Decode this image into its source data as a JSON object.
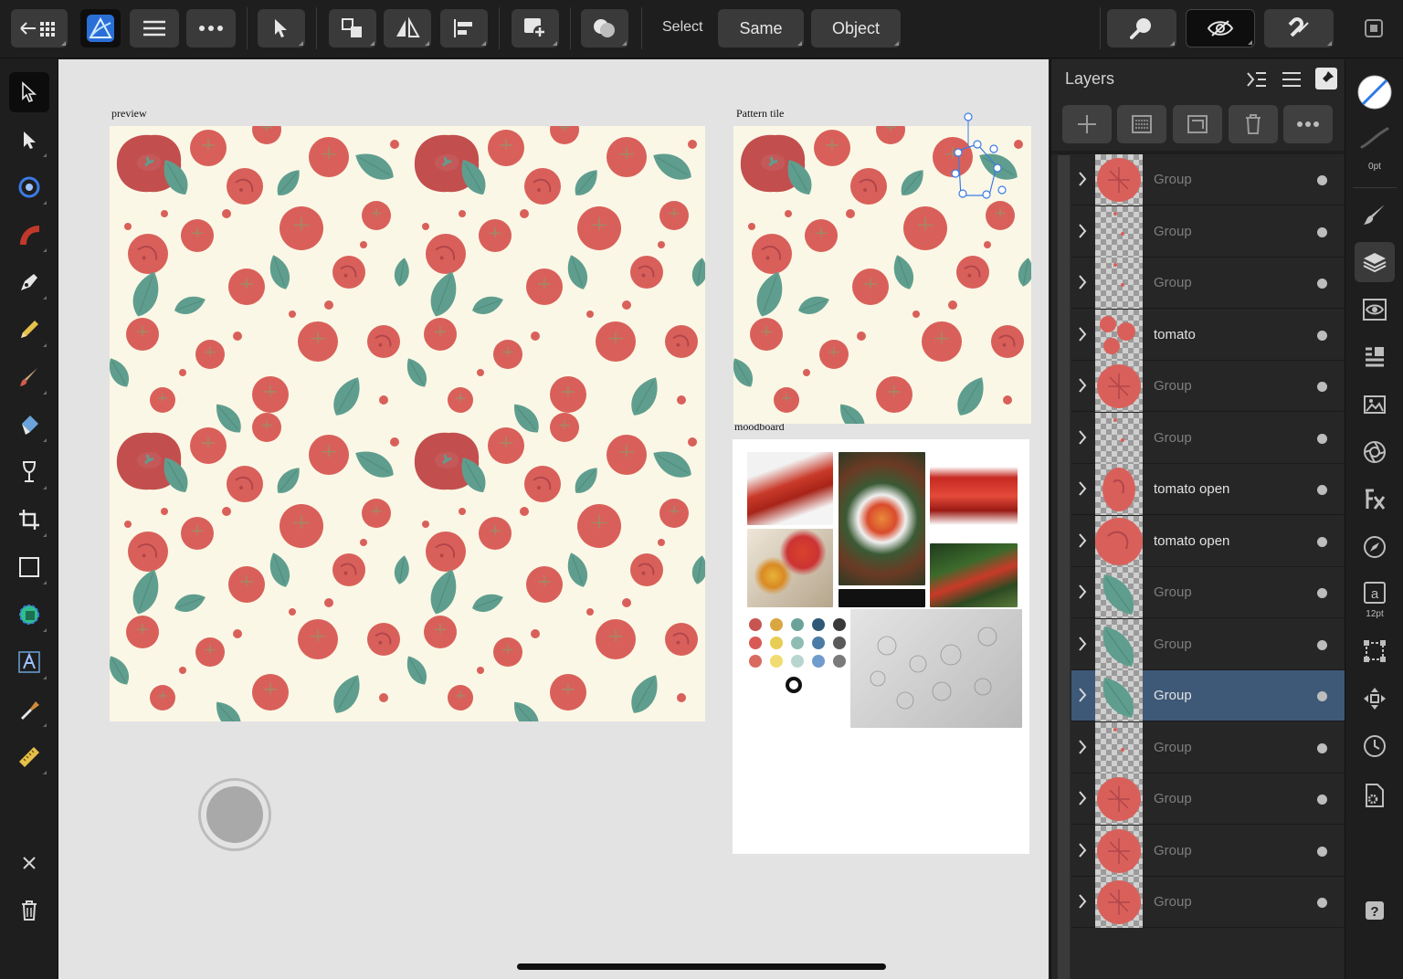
{
  "toolbar": {
    "select_label": "Select",
    "same_label": "Same",
    "object_label": "Object"
  },
  "artboards": {
    "preview_label": "preview",
    "tile_label": "Pattern tile",
    "moodboard_label": "moodboard"
  },
  "layers": {
    "title": "Layers",
    "rows": [
      {
        "name": "Group",
        "thumb": "tomato-slice",
        "enabled": false,
        "selected": false
      },
      {
        "name": "Group",
        "thumb": "transparent",
        "enabled": false,
        "selected": false
      },
      {
        "name": "Group",
        "thumb": "transparent",
        "enabled": false,
        "selected": false
      },
      {
        "name": "tomato",
        "thumb": "tomatoes",
        "enabled": true,
        "selected": false
      },
      {
        "name": "Group",
        "thumb": "tomato-slice",
        "enabled": false,
        "selected": false
      },
      {
        "name": "Group",
        "thumb": "transparent",
        "enabled": false,
        "selected": false
      },
      {
        "name": "tomato open",
        "thumb": "tomato-open",
        "enabled": true,
        "selected": false
      },
      {
        "name": "tomato open",
        "thumb": "tomato-open-big",
        "enabled": true,
        "selected": false
      },
      {
        "name": "Group",
        "thumb": "leaf",
        "enabled": false,
        "selected": false
      },
      {
        "name": "Group",
        "thumb": "leaf",
        "enabled": false,
        "selected": false
      },
      {
        "name": "Group",
        "thumb": "leaf",
        "enabled": true,
        "selected": true
      },
      {
        "name": "Group",
        "thumb": "transparent",
        "enabled": false,
        "selected": false
      },
      {
        "name": "Group",
        "thumb": "tomato-slice",
        "enabled": false,
        "selected": false
      },
      {
        "name": "Group",
        "thumb": "tomato-slice",
        "enabled": false,
        "selected": false
      },
      {
        "name": "Group",
        "thumb": "tomato-slice",
        "enabled": false,
        "selected": false
      }
    ]
  },
  "studio": {
    "stroke_width": "0pt",
    "text_size": "12pt"
  },
  "colors": {
    "tomato": "#d9605a",
    "tomato_dark": "#c24f4e",
    "leaf": "#5f9e8e",
    "pattern_bg": "#fbf7e6",
    "selection": "#3e5878",
    "accent_blue": "#2c7be5"
  },
  "moodboard_swatches": [
    "#c85552",
    "#d9a640",
    "#6aa39a",
    "#2e5876",
    "#3a3a3a",
    "#d95a55",
    "#e8cd55",
    "#8fbdb4",
    "#4b7ca5",
    "#5a5a5a",
    "#d96a60",
    "#f0dc70",
    "#b8d6cf",
    "#6f9ccc",
    "#7a7a7a"
  ]
}
